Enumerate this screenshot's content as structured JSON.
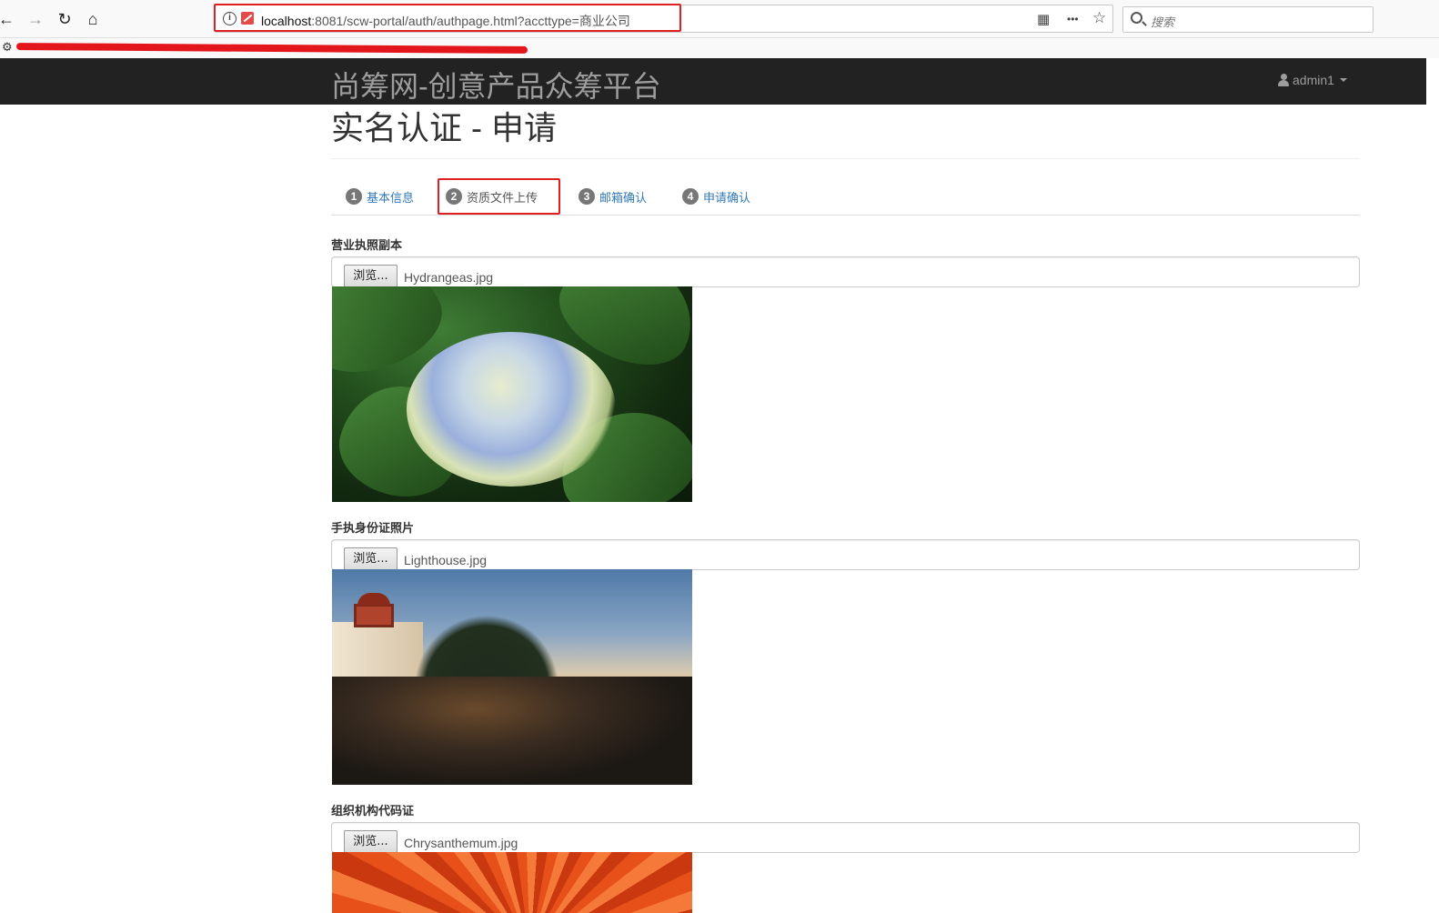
{
  "browser": {
    "url_host": "localhost",
    "url_rest": ":8081/scw-portal/auth/authpage.html?accttype=商业公司",
    "search_placeholder": "搜索",
    "more_icon": "•••"
  },
  "navbar": {
    "brand": "尚筹网-创意产品众筹平台",
    "user": "admin1"
  },
  "page": {
    "title": "实名认证 - 申请"
  },
  "tabs": [
    {
      "num": "1",
      "label": "基本信息"
    },
    {
      "num": "2",
      "label": "资质文件上传"
    },
    {
      "num": "3",
      "label": "邮箱确认"
    },
    {
      "num": "4",
      "label": "申请确认"
    }
  ],
  "uploads": [
    {
      "label": "营业执照副本",
      "button": "浏览...",
      "file": "Hydrangeas.jpg"
    },
    {
      "label": "手执身份证照片",
      "button": "浏览...",
      "file": "Lighthouse.jpg"
    },
    {
      "label": "组织机构代码证",
      "button": "浏览...",
      "file": "Chrysanthemum.jpg"
    }
  ],
  "colors": {
    "navbar_bg": "#222222",
    "link": "#337ab7",
    "highlight": "#e02020"
  }
}
